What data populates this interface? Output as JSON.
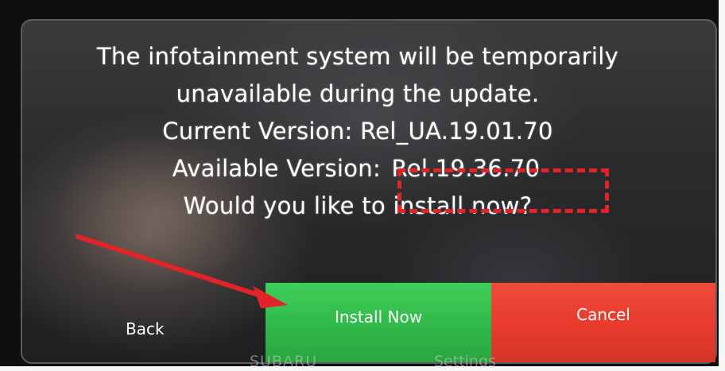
{
  "dialog": {
    "line1": "The infotainment system will be temporarily",
    "line2": "unavailable during the update.",
    "current_version_text": "Current Version: Rel_UA.19.01.70",
    "available_label": "Available Version: ",
    "available_value": "Rel.19.36.70",
    "question": "Would you like to install now?"
  },
  "buttons": {
    "back": "Back",
    "install": "Install Now",
    "cancel": "Cancel"
  },
  "background_labels": {
    "left": "SUBARU",
    "right": "Settings"
  },
  "colors": {
    "install_button": "#2fb649",
    "cancel_button": "#e63a2c",
    "annotation_red": "#e3222a"
  },
  "icons": {
    "annotation_arrow": "red-arrow-icon",
    "annotation_box": "dashed-highlight-box"
  }
}
